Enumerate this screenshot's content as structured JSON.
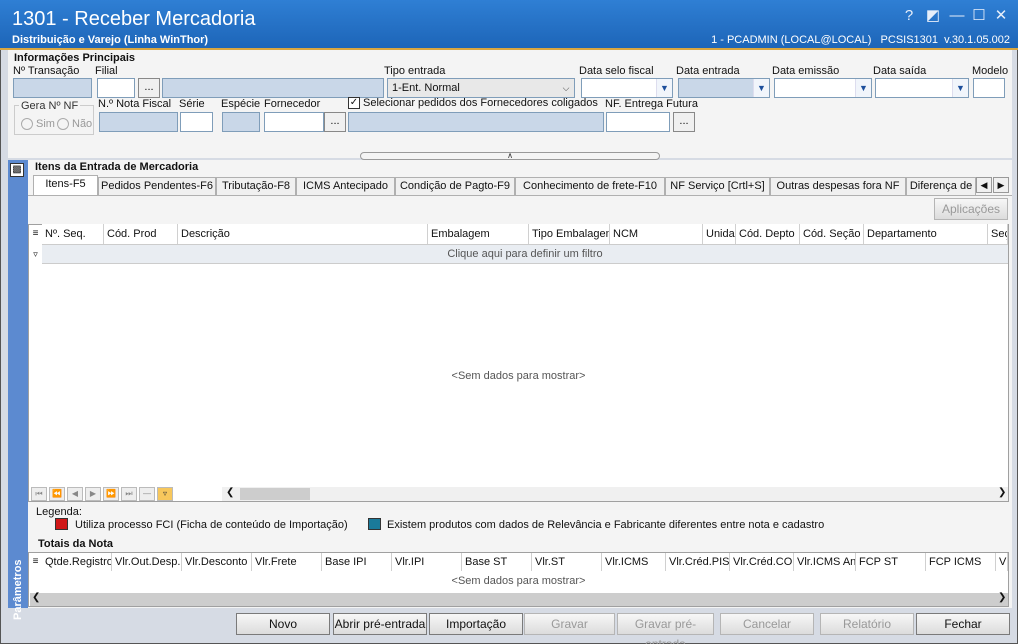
{
  "window": {
    "title": "1301 - Receber Mercadoria",
    "subtitle": "Distribuição e Varejo (Linha WinThor)",
    "connection": "1 - PCADMIN (LOCAL@LOCAL)   PCSIS1301  v.30.1.05.002",
    "controls": [
      "?",
      "◩",
      "—",
      "☐",
      "✕"
    ]
  },
  "main": {
    "section_title": "Informações Principais",
    "fields": {
      "transacao_label": "Nº Transação",
      "filial_label": "Filial",
      "filial_dots": "...",
      "tipo_entrada_label": "Tipo entrada",
      "tipo_entrada_value": "1-Ent. Normal",
      "data_selo_label": "Data selo fiscal",
      "data_entrada_label": "Data entrada",
      "data_emissao_label": "Data emissão",
      "data_saida_label": "Data saída",
      "modelo_label": "Modelo",
      "gera_nf_label": "Gera Nº NF",
      "sim_label": "Sim",
      "nao_label": "Não",
      "nota_fiscal_label": "N.º Nota Fiscal",
      "serie_label": "Série",
      "especie_label": "Espécie",
      "fornecedor_label": "Fornecedor",
      "fornecedor_dots": "...",
      "coligados_label": "Selecionar pedidos dos Fornecedores coligados",
      "coligados_checked": "✓",
      "nf_entrega_label": "NF. Entrega Futura",
      "nf_entrega_dots": "..."
    }
  },
  "items": {
    "section_title": "Itens da Entrada de Mercadoria",
    "tabs": [
      "Itens-F5",
      "Pedidos Pendentes-F6",
      "Tributação-F8",
      "ICMS Antecipado",
      "Condição de Pagto-F9",
      "Conhecimento de frete-F10",
      "NF Serviço [Crtl+S]",
      "Outras despesas fora NF",
      "Diferença de"
    ],
    "aplicacoes_button": "Aplicações",
    "columns": [
      "Nº. Seq.",
      "Cód. Prod",
      "Descrição",
      "Embalagem",
      "Tipo Embalagem",
      "NCM",
      "Unida",
      "Cód. Depto",
      "Cód. Seção",
      "Departamento",
      "Seç"
    ],
    "filter_text": "Clique aqui para definir um filtro",
    "empty_text": "<Sem dados para mostrar>"
  },
  "legend": {
    "title": "Legenda:",
    "items": [
      {
        "label": "Utiliza processo FCI (Ficha de conteúdo de Importação)",
        "color": "#d01818"
      },
      {
        "label": "Existem produtos com dados de Relevância e Fabricante diferentes entre nota e cadastro",
        "color": "#1a7a9a"
      }
    ]
  },
  "totals": {
    "section_title": "Totais da Nota",
    "columns": [
      "Qtde.Registro",
      "Vlr.Out.Desp.",
      "Vlr.Desconto",
      "Vlr.Frete",
      "Base IPI",
      "Vlr.IPI",
      "Base ST",
      "Vlr.ST",
      "Vlr.ICMS",
      "Vlr.Créd.PIS",
      "Vlr.Créd.CO",
      "Vlr.ICMS Ant",
      "FCP ST",
      "FCP ICMS",
      "Vl"
    ],
    "empty_text": "<Sem dados para mostrar>"
  },
  "sidebar": {
    "label": "Parâmetros"
  },
  "buttons": [
    {
      "label": "Novo",
      "enabled": true
    },
    {
      "label": "Abrir pré-entrada",
      "enabled": true
    },
    {
      "label": "Importação",
      "enabled": true
    },
    {
      "label": "Gravar",
      "enabled": false
    },
    {
      "label": "Gravar pré-entrada",
      "enabled": false
    },
    {
      "label": "Cancelar",
      "enabled": false
    },
    {
      "label": "Relatório",
      "enabled": false
    },
    {
      "label": "Fechar",
      "enabled": true
    }
  ],
  "colors": {
    "titlebar": "#1d65b8",
    "sidebar": "#5c8ad0",
    "field_readonly": "#c9d7e8"
  }
}
